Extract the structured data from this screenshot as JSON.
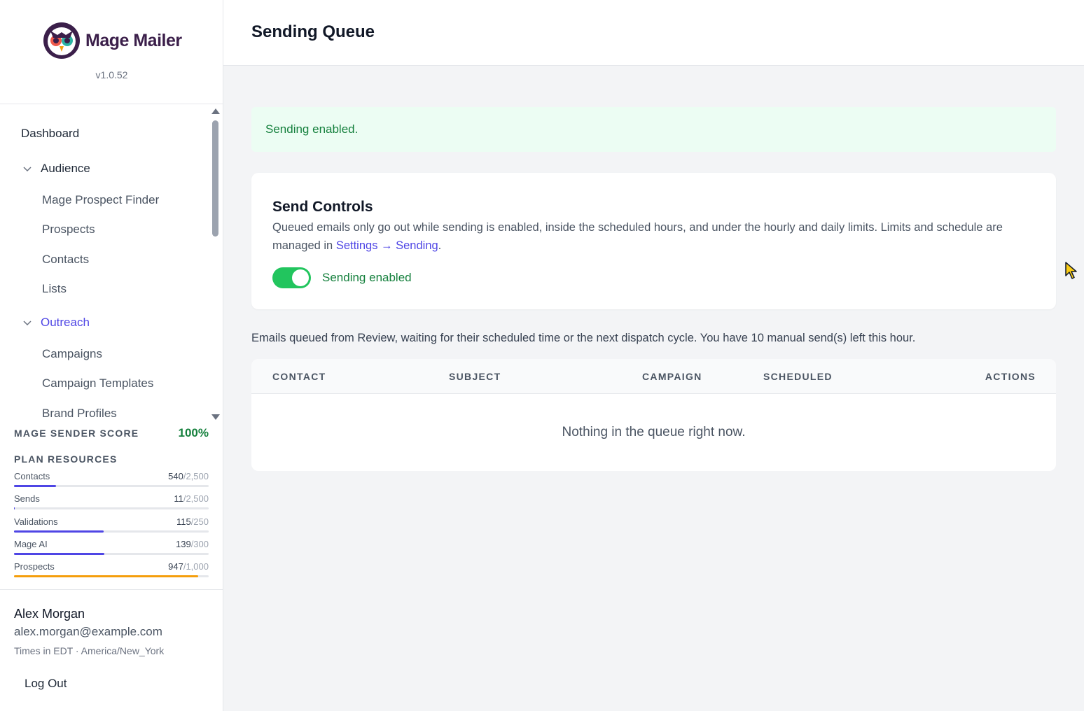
{
  "brand": {
    "name": "Mage Mailer",
    "version": "v1.0.52",
    "colors": {
      "primary": "#3b1f4a",
      "accent": "#4f46e5",
      "success": "#22c55e"
    }
  },
  "sidebar": {
    "nav": {
      "dashboard": "Dashboard",
      "audience": {
        "label": "Audience",
        "items": [
          "Mage Prospect Finder",
          "Prospects",
          "Contacts",
          "Lists"
        ]
      },
      "outreach": {
        "label": "Outreach",
        "items": [
          "Campaigns",
          "Campaign Templates",
          "Brand Profiles"
        ]
      }
    },
    "score": {
      "label": "MAGE SENDER SCORE",
      "value": "100%"
    },
    "plan": {
      "label": "PLAN RESOURCES",
      "resources": [
        {
          "name": "Contacts",
          "used": "540",
          "total": "/2,500",
          "fraction": 0.216
        },
        {
          "name": "Sends",
          "used": "11",
          "total": "/2,500",
          "fraction": 0.0044
        },
        {
          "name": "Validations",
          "used": "115",
          "total": "/250",
          "fraction": 0.46
        },
        {
          "name": "Mage AI",
          "used": "139",
          "total": "/300",
          "fraction": 0.463
        },
        {
          "name": "Prospects",
          "used": "947",
          "total": "/1,000",
          "fraction": 0.947
        }
      ]
    },
    "user": {
      "name": "Alex Morgan",
      "email": "alex.morgan@example.com",
      "timezone": "Times in EDT · America/New_York",
      "logout": "Log Out"
    }
  },
  "header": {
    "title": "Sending Queue"
  },
  "alert": {
    "message": "Sending enabled."
  },
  "send_controls": {
    "title": "Send Controls",
    "description_prefix": "Queued emails only go out while sending is enabled, inside the scheduled hours, and under the hourly and daily limits. Limits and schedule are managed in ",
    "description_link": "Settings → Sending",
    "description_suffix": ".",
    "toggle_label": "Sending enabled",
    "toggle_on": true
  },
  "queue": {
    "note": "Emails queued from Review, waiting for their scheduled time or the next dispatch cycle. You have 10 manual send(s) left this hour.",
    "columns": [
      "CONTACT",
      "SUBJECT",
      "CAMPAIGN",
      "SCHEDULED",
      "ACTIONS"
    ],
    "empty_message": "Nothing in the queue right now."
  }
}
